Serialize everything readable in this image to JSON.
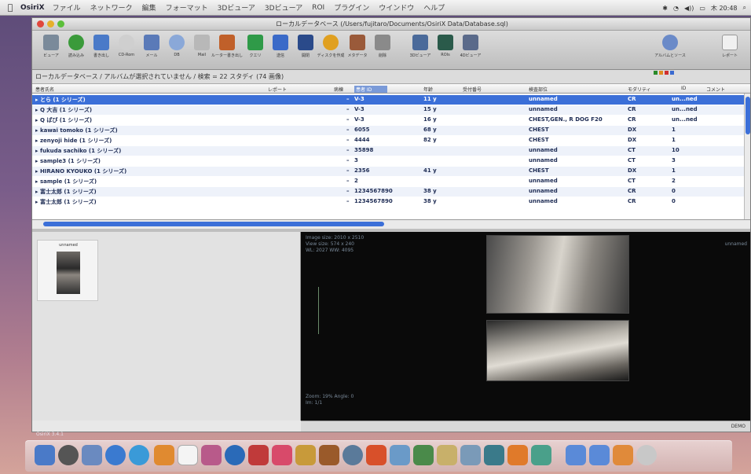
{
  "menubar": {
    "app": "OsiriX",
    "items": [
      "ファイル",
      "ネットワーク",
      "編集",
      "フォーマット",
      "3Dビューア",
      "3Dビューア",
      "ROI",
      "プラグイン",
      "ウインドウ",
      "ヘルプ"
    ],
    "clock": "木 20:48"
  },
  "window": {
    "title": "ローカルデータベース (/Users/fujitaro/Documents/OsiriX Data/Database.sql)",
    "toolbar": [
      "ビューア",
      "読み込み",
      "書き出し",
      "CD-Rom",
      "メール",
      "DB",
      "Mail",
      "ルーター書き出し",
      "クエリ",
      "送信",
      "開閉",
      "ディスクを作成",
      "メタデータ",
      "削除",
      "3Dビューア",
      "ROIs",
      "4Dビューア",
      "アルバムとソース",
      "レポート"
    ],
    "breadcrumb": "ローカルデータベース / アルバムが選択されていません / 検索 = 22 スタディ (74 画像)"
  },
  "columns": [
    "患者氏名",
    "レポート",
    "病棟",
    "患者 ID",
    "年齢",
    "受付番号",
    "検査部位",
    "モダリティ",
    "ID",
    "コメント"
  ],
  "rows": [
    {
      "name": "▸ とら (1 シリーズ)",
      "lock": "–",
      "pid": "V-3",
      "age": "11 y",
      "acc": "",
      "desc": "unnamed",
      "mod": "CR",
      "num": "un...ned",
      "selected": true
    },
    {
      "name": "▸ Q 大吉 (1 シリーズ)",
      "lock": "–",
      "pid": "V-3",
      "age": "15 y",
      "acc": "",
      "desc": "unnamed",
      "mod": "CR",
      "num": "un...ned"
    },
    {
      "name": "▸ Q ぱぴ (1 シリーズ)",
      "lock": "–",
      "pid": "V-3",
      "age": "16 y",
      "acc": "",
      "desc": "CHEST,GEN., R DOG F20",
      "mod": "CR",
      "num": "un...ned"
    },
    {
      "name": "▸ kawai tomoko (1 シリーズ)",
      "lock": "–",
      "pid": "6055",
      "age": "68 y",
      "acc": "",
      "desc": "CHEST",
      "mod": "DX",
      "num": "1"
    },
    {
      "name": "▸ zenyoji hide (1 シリーズ)",
      "lock": "–",
      "pid": "4444",
      "age": "82 y",
      "acc": "",
      "desc": "CHEST",
      "mod": "DX",
      "num": "1"
    },
    {
      "name": "▸ fukuda sachiko (1 シリーズ)",
      "lock": "–",
      "pid": "35898",
      "age": "",
      "acc": "",
      "desc": "unnamed",
      "mod": "CT",
      "num": "10"
    },
    {
      "name": "▸ sample3 (1 シリーズ)",
      "lock": "–",
      "pid": "3",
      "age": "",
      "acc": "",
      "desc": "unnamed",
      "mod": "CT",
      "num": "3"
    },
    {
      "name": "▸ HIRANO KYOUKO (1 シリーズ)",
      "lock": "–",
      "pid": "2356",
      "age": "41 y",
      "acc": "",
      "desc": "CHEST",
      "mod": "DX",
      "num": "1"
    },
    {
      "name": "▸ sample (1 シリーズ)",
      "lock": "–",
      "pid": "2",
      "age": "",
      "acc": "",
      "desc": "unnamed",
      "mod": "CT",
      "num": "2"
    },
    {
      "name": "▸ 富士太郎 (1 シリーズ)",
      "lock": "–",
      "pid": "1234567890",
      "age": "38 y",
      "acc": "",
      "desc": "unnamed",
      "mod": "CR",
      "num": "0"
    },
    {
      "name": "▸ 富士太郎 (1 シリーズ)",
      "lock": "–",
      "pid": "1234567890",
      "age": "38 y",
      "acc": "",
      "desc": "unnamed",
      "mod": "CR",
      "num": "0"
    }
  ],
  "thumbnail": {
    "caption": "unnamed"
  },
  "viewer": {
    "overlay_tl": [
      "Image size: 2010 x 2510",
      "View size: 574 x 240",
      "WL: 2027 WW: 4095"
    ],
    "overlay_tr": [
      "unnamed"
    ],
    "overlay_bl": [
      "Zoom: 19% Angle: 0",
      "Im: 1/1"
    ],
    "status": "DEMO"
  },
  "footer_text": "OsiriX 3.4.1"
}
